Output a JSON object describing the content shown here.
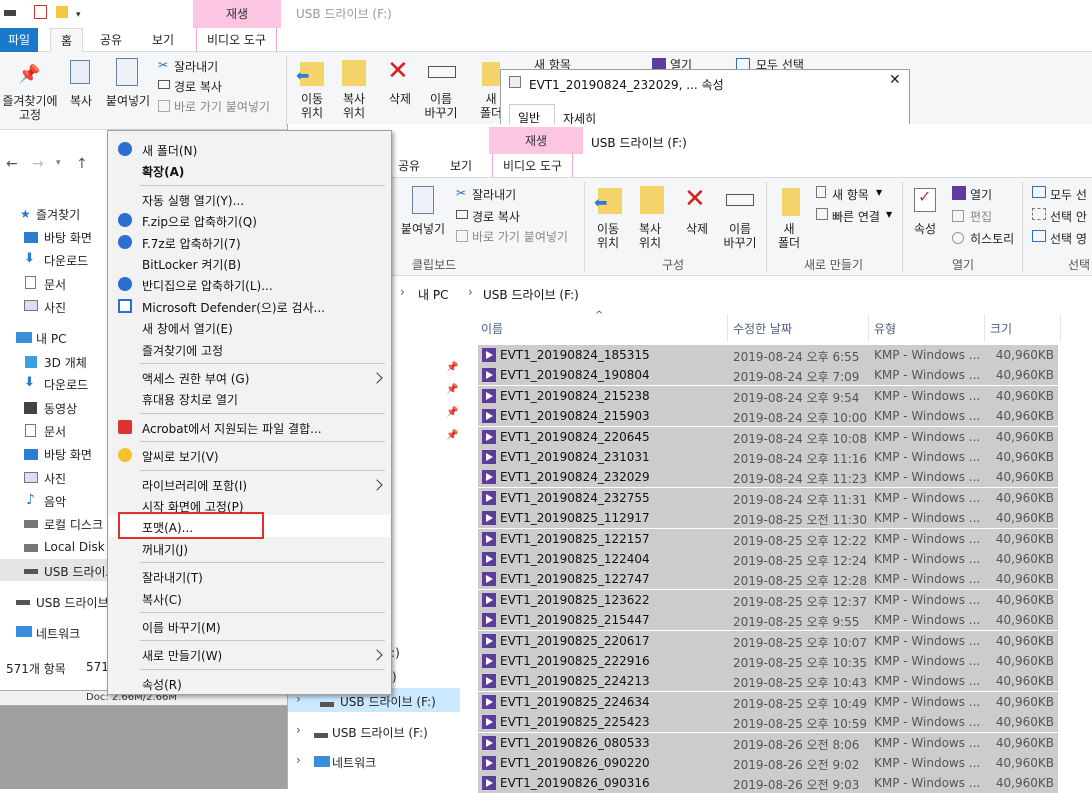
{
  "back_window": {
    "title": "USB 드라이브 (F:)",
    "context_tab": "재생",
    "tabs": [
      "파일",
      "홈",
      "공유",
      "보기",
      "비디오 도구"
    ],
    "pin_label": "즐겨찾기에\n고정",
    "copy_label": "복사",
    "paste_label": "붙여넣기",
    "cut_label": "잘라내기",
    "copy_path_label": "경로 복사",
    "paste_shortcut_label": "바로 가기 붙여넣기",
    "clipboard_group": "클립보드",
    "move_label": "이동\n위치",
    "copyto_label": "복사\n위치",
    "delete_label": "삭제",
    "rename_label": "이름\n바꾸기",
    "new_label": "새\n폴더",
    "new_item_label": "새 항목",
    "open_label": "열기",
    "select_all_label": "모두 선택",
    "nav": {
      "favorites": "즐겨찾기",
      "favorites_items": [
        "바탕 화면",
        "다운로드",
        "문서",
        "사진"
      ],
      "this_pc": "내 PC",
      "pc_items": [
        "3D 개체",
        "다운로드",
        "동영상",
        "문서",
        "바탕 화면",
        "사진",
        "음악",
        "로컬 디스크",
        "Local Disk (",
        "USB 드라이브"
      ],
      "usb": "USB 드라이브",
      "network": "네트워크"
    },
    "status_left": "571개 항목",
    "status_mid": "571",
    "doc_status": "Doc: 2.66M/2.66M"
  },
  "properties_dialog": {
    "title": "EVT1_20190824_232029, ... 속성",
    "tabs": [
      "일반",
      "자세히"
    ]
  },
  "front_window": {
    "title": "USB 드라이브 (F:)",
    "context_tab": "재생",
    "tabs": [
      "공유",
      "보기",
      "비디오 도구"
    ],
    "ribbon": {
      "paste_label": "붙여넣기",
      "cut_label": "잘라내기",
      "copy_path_label": "경로 복사",
      "paste_shortcut_label": "바로 가기 붙여넣기",
      "clipboard_group": "클립보드",
      "move_label": "이동\n위치",
      "copyto_label": "복사\n위치",
      "delete_label": "삭제",
      "rename_label": "이름\n바꾸기",
      "organize_group": "구성",
      "new_folder_label": "새\n폴더",
      "new_item_label": "새 항목",
      "easy_access_label": "빠른 연결",
      "new_group": "새로 만들기",
      "properties_label": "속성",
      "open_label": "열기",
      "edit_label": "편집",
      "history_label": "히스토리",
      "open_group": "열기",
      "select_all_label": "모두 선",
      "select_none_label": "선택 안",
      "invert_label": "선택 영",
      "select_group": "선택"
    },
    "breadcrumb": [
      "내 PC",
      "USB 드라이브 (F:)"
    ],
    "columns": {
      "name": "이름",
      "date": "수정한 날짜",
      "type": "유형",
      "size": "크기"
    },
    "nav_partial": [
      "(C:)",
      "(D:)"
    ],
    "nav_usb_selected": "USB 드라이브 (F:)",
    "nav_usb": "USB 드라이브 (F:)",
    "nav_network": "네트워크",
    "files": [
      {
        "name": "EVT1_20190824_185315",
        "date": "2019-08-24 오후 6:55",
        "type": "KMP - Windows ...",
        "size": "40,960KB"
      },
      {
        "name": "EVT1_20190824_190804",
        "date": "2019-08-24 오후 7:09",
        "type": "KMP - Windows ...",
        "size": "40,960KB"
      },
      {
        "name": "EVT1_20190824_215238",
        "date": "2019-08-24 오후 9:54",
        "type": "KMP - Windows ...",
        "size": "40,960KB"
      },
      {
        "name": "EVT1_20190824_215903",
        "date": "2019-08-24 오후 10:00",
        "type": "KMP - Windows ...",
        "size": "40,960KB"
      },
      {
        "name": "EVT1_20190824_220645",
        "date": "2019-08-24 오후 10:08",
        "type": "KMP - Windows ...",
        "size": "40,960KB"
      },
      {
        "name": "EVT1_20190824_231031",
        "date": "2019-08-24 오후 11:16",
        "type": "KMP - Windows ...",
        "size": "40,960KB"
      },
      {
        "name": "EVT1_20190824_232029",
        "date": "2019-08-24 오후 11:23",
        "type": "KMP - Windows ...",
        "size": "40,960KB"
      },
      {
        "name": "EVT1_20190824_232755",
        "date": "2019-08-24 오후 11:31",
        "type": "KMP - Windows ...",
        "size": "40,960KB"
      },
      {
        "name": "EVT1_20190825_112917",
        "date": "2019-08-25 오전 11:30",
        "type": "KMP - Windows ...",
        "size": "40,960KB"
      },
      {
        "name": "EVT1_20190825_122157",
        "date": "2019-08-25 오후 12:22",
        "type": "KMP - Windows ...",
        "size": "40,960KB"
      },
      {
        "name": "EVT1_20190825_122404",
        "date": "2019-08-25 오후 12:24",
        "type": "KMP - Windows ...",
        "size": "40,960KB"
      },
      {
        "name": "EVT1_20190825_122747",
        "date": "2019-08-25 오후 12:28",
        "type": "KMP - Windows ...",
        "size": "40,960KB"
      },
      {
        "name": "EVT1_20190825_123622",
        "date": "2019-08-25 오후 12:37",
        "type": "KMP - Windows ...",
        "size": "40,960KB"
      },
      {
        "name": "EVT1_20190825_215447",
        "date": "2019-08-25 오후 9:55",
        "type": "KMP - Windows ...",
        "size": "40,960KB"
      },
      {
        "name": "EVT1_20190825_220617",
        "date": "2019-08-25 오후 10:07",
        "type": "KMP - Windows ...",
        "size": "40,960KB"
      },
      {
        "name": "EVT1_20190825_222916",
        "date": "2019-08-25 오후 10:35",
        "type": "KMP - Windows ...",
        "size": "40,960KB"
      },
      {
        "name": "EVT1_20190825_224213",
        "date": "2019-08-25 오후 10:43",
        "type": "KMP - Windows ...",
        "size": "40,960KB"
      },
      {
        "name": "EVT1_20190825_224634",
        "date": "2019-08-25 오후 10:49",
        "type": "KMP - Windows ...",
        "size": "40,960KB"
      },
      {
        "name": "EVT1_20190825_225423",
        "date": "2019-08-25 오후 10:59",
        "type": "KMP - Windows ...",
        "size": "40,960KB"
      },
      {
        "name": "EVT1_20190826_080533",
        "date": "2019-08-26 오전 8:06",
        "type": "KMP - Windows ...",
        "size": "40,960KB"
      },
      {
        "name": "EVT1_20190826_090220",
        "date": "2019-08-26 오전 9:02",
        "type": "KMP - Windows ...",
        "size": "40,960KB"
      },
      {
        "name": "EVT1_20190826_090316",
        "date": "2019-08-26 오전 9:03",
        "type": "KMP - Windows ...",
        "size": "40,960KB"
      }
    ]
  },
  "context_menu": {
    "items": [
      {
        "label": "새 폴더(N)",
        "icon": "shield-icon"
      },
      {
        "label": "확장(A)",
        "bold": true
      },
      {
        "sep": true
      },
      {
        "label": "자동 실행 열기(Y)..."
      },
      {
        "label": "F.zip으로 압축하기(Q)",
        "icon": "zip-icon"
      },
      {
        "label": "F.7z로 압축하기(7)",
        "icon": "zip-icon"
      },
      {
        "label": "BitLocker 켜기(B)"
      },
      {
        "label": "반디집으로 압축하기(L)...",
        "icon": "zip-icon"
      },
      {
        "label": "Microsoft Defender(으)로 검사...",
        "icon": "defender-icon"
      },
      {
        "label": "새 창에서 열기(E)"
      },
      {
        "label": "즐겨찾기에 고정"
      },
      {
        "sep": true
      },
      {
        "label": "액세스 권한 부여 (G)",
        "submenu": true
      },
      {
        "label": "휴대용 장치로 열기"
      },
      {
        "sep": true
      },
      {
        "label": "Acrobat에서 지원되는 파일 결합...",
        "icon": "acrobat-icon"
      },
      {
        "sep": true
      },
      {
        "label": "알씨로 보기(V)",
        "icon": "alsee-icon"
      },
      {
        "sep": true
      },
      {
        "label": "라이브러리에 포함(I)",
        "submenu": true
      },
      {
        "label": "시작 화면에 고정(P)"
      },
      {
        "label": "포맷(A)...",
        "highlight": true
      },
      {
        "label": "꺼내기(J)"
      },
      {
        "sep": true
      },
      {
        "label": "잘라내기(T)"
      },
      {
        "label": "복사(C)"
      },
      {
        "sep": true
      },
      {
        "label": "이름 바꾸기(M)"
      },
      {
        "sep": true
      },
      {
        "label": "새로 만들기(W)",
        "submenu": true
      },
      {
        "sep": true
      },
      {
        "label": "속성(R)"
      }
    ]
  }
}
